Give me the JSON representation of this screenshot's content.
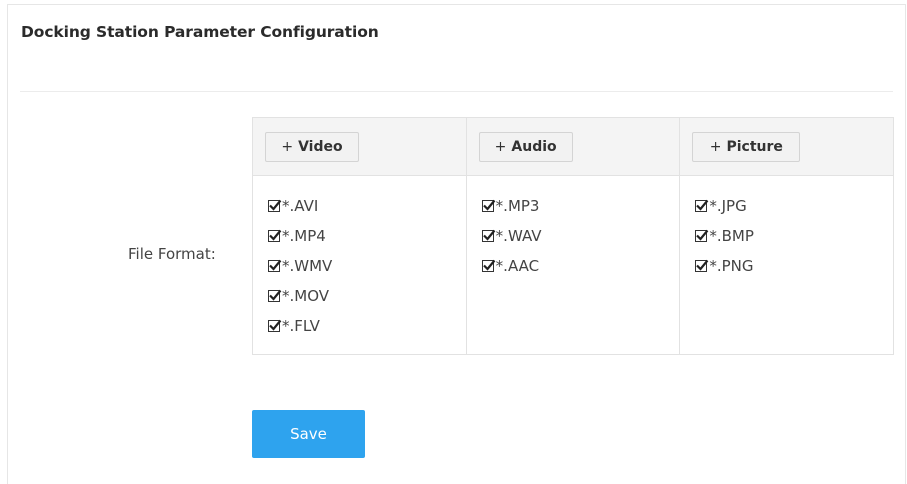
{
  "page": {
    "title": "Docking Station Parameter Configuration"
  },
  "form": {
    "file_format_label": "File Format:",
    "columns": [
      {
        "button_prefix": "+",
        "button_label": "Video",
        "options": [
          {
            "label": "*.AVI",
            "checked": true
          },
          {
            "label": "*.MP4",
            "checked": true
          },
          {
            "label": "*.WMV",
            "checked": true
          },
          {
            "label": "*.MOV",
            "checked": true
          },
          {
            "label": "*.FLV",
            "checked": true
          }
        ]
      },
      {
        "button_prefix": "+",
        "button_label": "Audio",
        "options": [
          {
            "label": "*.MP3",
            "checked": true
          },
          {
            "label": "*.WAV",
            "checked": true
          },
          {
            "label": "*.AAC",
            "checked": true
          }
        ]
      },
      {
        "button_prefix": "+",
        "button_label": "Picture",
        "options": [
          {
            "label": "*.JPG",
            "checked": true
          },
          {
            "label": "*.BMP",
            "checked": true
          },
          {
            "label": "*.PNG",
            "checked": true
          }
        ]
      }
    ],
    "save_label": "Save"
  },
  "colors": {
    "accent": "#2ea3ee",
    "header_bg": "#f4f4f4",
    "border": "#e2e2e2"
  },
  "icons": {
    "checkbox": "checkbox-checked-icon"
  }
}
